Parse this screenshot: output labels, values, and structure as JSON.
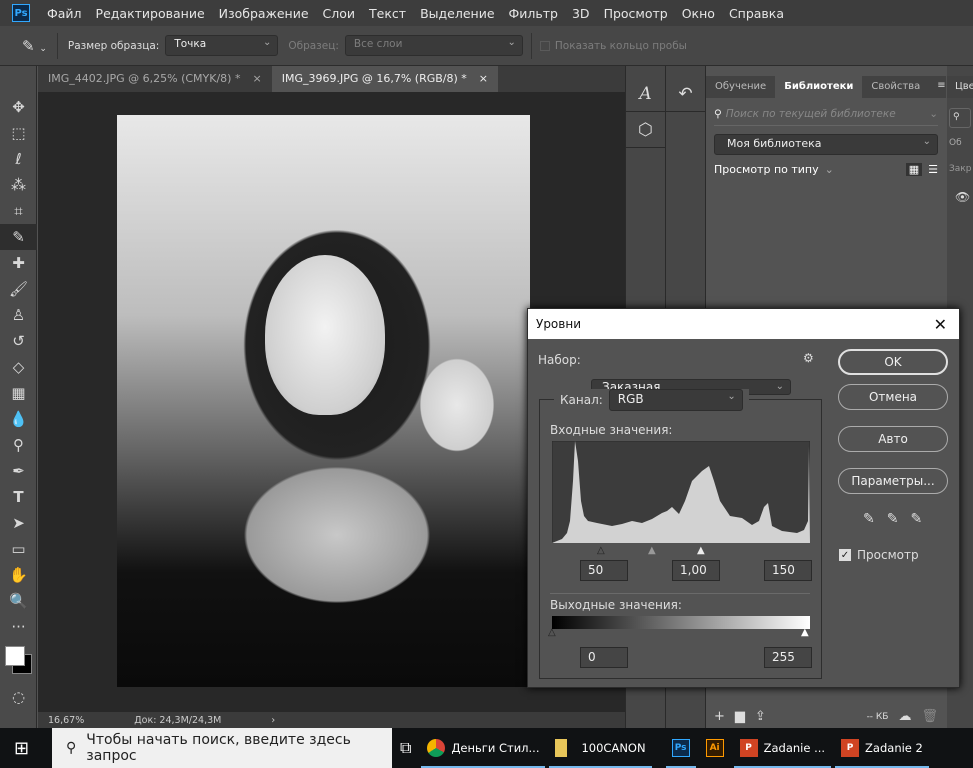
{
  "menu": [
    "Файл",
    "Редактирование",
    "Изображение",
    "Слои",
    "Текст",
    "Выделение",
    "Фильтр",
    "3D",
    "Просмотр",
    "Окно",
    "Справка"
  ],
  "app_logo": "Ps",
  "options": {
    "sample_size_label": "Размер образца:",
    "sample_size_value": "Точка",
    "sample_label": "Образец:",
    "sample_value": "Все слои",
    "show_ring_label": "Показать кольцо пробы"
  },
  "tabs": [
    {
      "label": "IMG_4402.JPG @ 6,25% (CMYK/8) *",
      "close": "×"
    },
    {
      "label": "IMG_3969.JPG @ 16,7% (RGB/8) *",
      "close": "×"
    }
  ],
  "status": {
    "zoom": "16,67%",
    "doc": "Док: 24,3M/24,3M",
    "arrow": "›"
  },
  "libraries": {
    "tabs": [
      "Обучение",
      "Библиотеки",
      "Свойства"
    ],
    "search_placeholder": "Поиск по текущей библиотеке",
    "library": "Моя библиотека",
    "view_by": "Просмотр по типу",
    "size": "-- КБ"
  },
  "far_panel": {
    "tab": "Цве",
    "field": "Об",
    "lock": "Закр"
  },
  "levels": {
    "title": "Уровни",
    "preset_label": "Набор:",
    "preset_value": "Заказная",
    "channel_label": "Канал:",
    "channel_value": "RGB",
    "input_label": "Входные значения:",
    "input_black": "50",
    "input_gamma": "1,00",
    "input_white": "150",
    "output_label": "Выходные значения:",
    "output_black": "0",
    "output_white": "255",
    "ok": "OK",
    "cancel": "Отмена",
    "auto": "Авто",
    "options": "Параметры...",
    "preview_label": "Просмотр",
    "preview_checked": true
  },
  "taskbar": {
    "search_placeholder": "Чтобы начать поиск, введите здесь запрос",
    "apps": [
      {
        "label": "Деньги Стил...",
        "icon": "chrome-icon"
      },
      {
        "label": "100CANON",
        "icon": "folder-icon"
      },
      {
        "label": "",
        "icon": "Ps"
      },
      {
        "label": "",
        "icon": "Ai"
      },
      {
        "label": "Zadanie ...",
        "icon": "powerpoint-icon"
      },
      {
        "label": "Zadanie 2",
        "icon": "powerpoint-icon"
      }
    ]
  },
  "colors": {
    "accent_taskbar": "#76b9ed",
    "ps_blue": "#31a8ff",
    "ai_orange": "#ff9a00"
  }
}
